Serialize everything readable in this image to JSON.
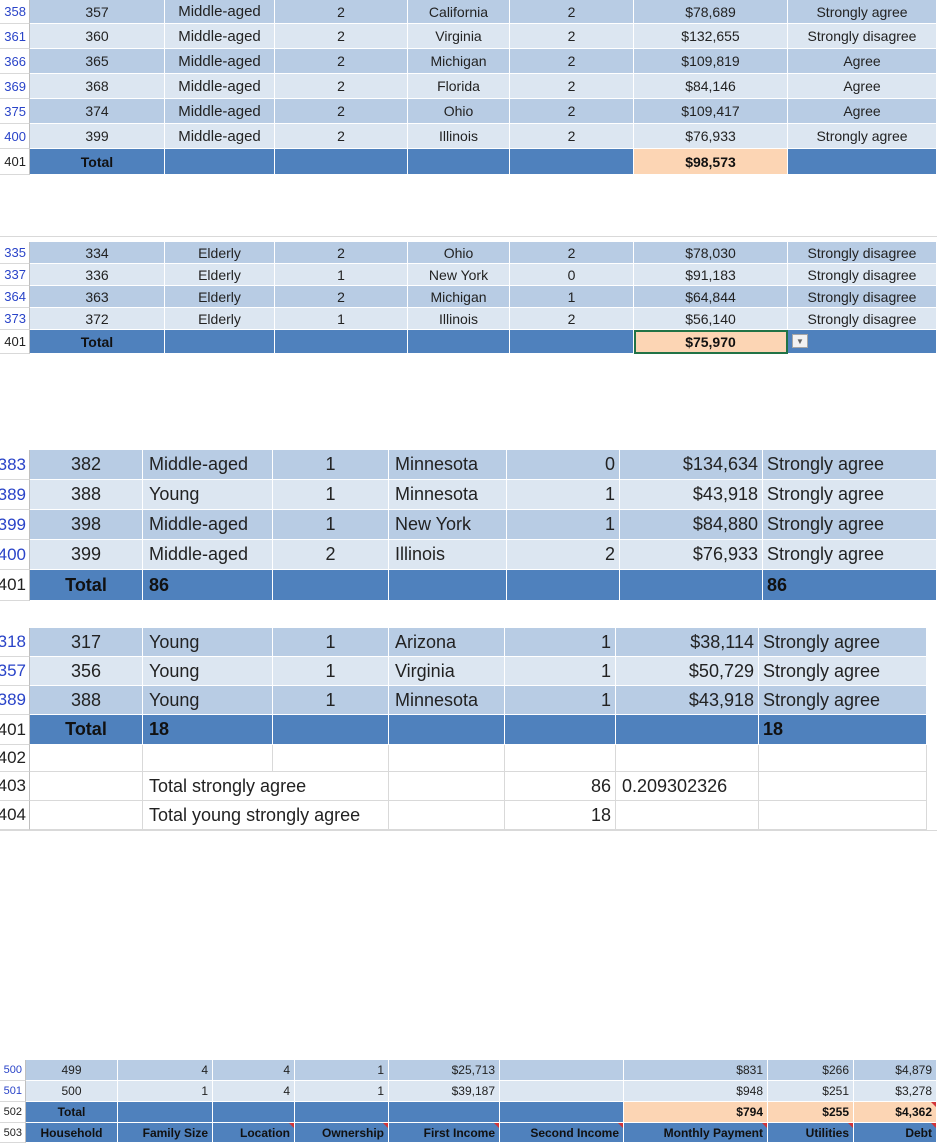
{
  "block1": {
    "rows": [
      {
        "num": "358",
        "cells": [
          "357",
          "Middle-aged",
          "2",
          "California",
          "2",
          "$78,689",
          "Strongly agree"
        ]
      },
      {
        "num": "361",
        "cells": [
          "360",
          "Middle-aged",
          "2",
          "Virginia",
          "2",
          "$132,655",
          "Strongly disagree"
        ]
      },
      {
        "num": "366",
        "cells": [
          "365",
          "Middle-aged",
          "2",
          "Michigan",
          "2",
          "$109,819",
          "Agree"
        ]
      },
      {
        "num": "369",
        "cells": [
          "368",
          "Middle-aged",
          "2",
          "Florida",
          "2",
          "$84,146",
          "Agree"
        ]
      },
      {
        "num": "375",
        "cells": [
          "374",
          "Middle-aged",
          "2",
          "Ohio",
          "2",
          "$109,417",
          "Agree"
        ]
      },
      {
        "num": "400",
        "cells": [
          "399",
          "Middle-aged",
          "2",
          "Illinois",
          "2",
          "$76,933",
          "Strongly agree"
        ]
      }
    ],
    "total": {
      "num": "401",
      "label": "Total",
      "value": "$98,573"
    }
  },
  "block2": {
    "rows": [
      {
        "num": "335",
        "cells": [
          "334",
          "Elderly",
          "2",
          "Ohio",
          "2",
          "$78,030",
          "Strongly disagree"
        ]
      },
      {
        "num": "337",
        "cells": [
          "336",
          "Elderly",
          "1",
          "New York",
          "0",
          "$91,183",
          "Strongly disagree"
        ]
      },
      {
        "num": "364",
        "cells": [
          "363",
          "Elderly",
          "2",
          "Michigan",
          "1",
          "$64,844",
          "Strongly disagree"
        ]
      },
      {
        "num": "373",
        "cells": [
          "372",
          "Elderly",
          "1",
          "Illinois",
          "2",
          "$56,140",
          "Strongly disagree"
        ]
      }
    ],
    "total": {
      "num": "401",
      "label": "Total",
      "value": "$75,970"
    }
  },
  "block3": {
    "rows": [
      {
        "num": "383",
        "cells": [
          "382",
          "Middle-aged",
          "1",
          "Minnesota",
          "0",
          "$134,634",
          "Strongly agree"
        ]
      },
      {
        "num": "389",
        "cells": [
          "388",
          "Young",
          "1",
          "Minnesota",
          "1",
          "$43,918",
          "Strongly agree"
        ]
      },
      {
        "num": "399",
        "cells": [
          "398",
          "Middle-aged",
          "1",
          "New York",
          "1",
          "$84,880",
          "Strongly agree"
        ]
      },
      {
        "num": "400",
        "cells": [
          "399",
          "Middle-aged",
          "2",
          "Illinois",
          "2",
          "$76,933",
          "Strongly agree"
        ]
      }
    ],
    "total": {
      "num": "401",
      "label": "Total",
      "count": "86",
      "count2": "86"
    }
  },
  "block4": {
    "rows": [
      {
        "num": "318",
        "cells": [
          "317",
          "Young",
          "1",
          "Arizona",
          "1",
          "$38,114",
          "Strongly agree"
        ]
      },
      {
        "num": "357",
        "cells": [
          "356",
          "Young",
          "1",
          "Virginia",
          "1",
          "$50,729",
          "Strongly agree"
        ]
      },
      {
        "num": "389",
        "cells": [
          "388",
          "Young",
          "1",
          "Minnesota",
          "1",
          "$43,918",
          "Strongly agree"
        ]
      }
    ],
    "total": {
      "num": "401",
      "label": "Total",
      "count": "18",
      "count2": "18"
    },
    "extra": [
      {
        "num": "402",
        "label": "",
        "value": "",
        "ratio": ""
      },
      {
        "num": "403",
        "label": "Total strongly agree",
        "value": "86",
        "ratio": "0.209302326"
      },
      {
        "num": "404",
        "label": "Total young strongly agree",
        "value": "18",
        "ratio": ""
      }
    ]
  },
  "block5": {
    "rows": [
      {
        "num": "500",
        "cells": [
          "499",
          "4",
          "4",
          "1",
          "$25,713",
          "",
          "$831",
          "$266",
          "$4,879"
        ]
      },
      {
        "num": "501",
        "cells": [
          "500",
          "1",
          "4",
          "1",
          "$39,187",
          "",
          "$948",
          "$251",
          "$3,278"
        ]
      }
    ],
    "total": {
      "num": "502",
      "label": "Total",
      "cells": [
        "$794",
        "$255",
        "$4,362"
      ]
    },
    "headers": {
      "num": "503",
      "cells": [
        "Household",
        "Family Size",
        "Location",
        "Ownership",
        "First Income",
        "Second Income",
        "Monthly Payment",
        "Utilities",
        "Debt"
      ]
    }
  }
}
